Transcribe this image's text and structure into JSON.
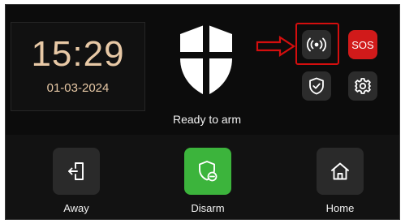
{
  "clock": {
    "time": "15:29",
    "date": "01-03-2024"
  },
  "status": {
    "text": "Ready to arm",
    "icon": "shield-icon"
  },
  "quick_actions": {
    "broadcast_icon": "broadcast-icon",
    "sos_label": "SOS",
    "verify_icon": "shield-check-icon",
    "settings_icon": "gear-icon"
  },
  "modes": [
    {
      "label": "Away",
      "icon": "exit-door-icon"
    },
    {
      "label": "Disarm",
      "icon": "shield-minus-icon"
    },
    {
      "label": "Home",
      "icon": "home-icon"
    }
  ],
  "colors": {
    "clock_text": "#e8c9a6",
    "sos": "#d11a1a",
    "disarm_active": "#3cb43c",
    "annotation": "#d40e0e"
  }
}
